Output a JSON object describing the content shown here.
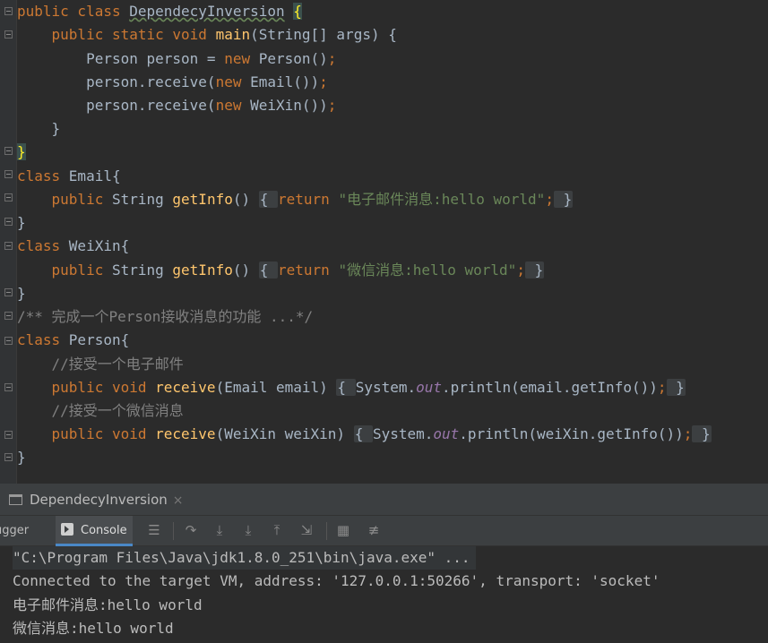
{
  "editor": {
    "lines": [
      [
        {
          "t": "public class ",
          "c": "kw"
        },
        {
          "t": "DependecyInversion",
          "c": "ul"
        },
        {
          "t": " "
        },
        {
          "t": "{",
          "c": "brhl"
        }
      ],
      [
        {
          "t": "    public static void ",
          "c": "kw"
        },
        {
          "t": "main",
          "c": "fn"
        },
        {
          "t": "(String[] args) {"
        }
      ],
      [
        {
          "t": "        Person person = "
        },
        {
          "t": "new ",
          "c": "kw"
        },
        {
          "t": "Person()"
        },
        {
          "t": ";",
          "c": "kw"
        }
      ],
      [
        {
          "t": "        person.receive("
        },
        {
          "t": "new ",
          "c": "kw"
        },
        {
          "t": "Email())"
        },
        {
          "t": ";",
          "c": "kw"
        }
      ],
      [
        {
          "t": "        person.receive("
        },
        {
          "t": "new ",
          "c": "kw"
        },
        {
          "t": "WeiXin())"
        },
        {
          "t": ";",
          "c": "kw"
        }
      ],
      [
        {
          "t": "    }"
        }
      ],
      [
        {
          "t": "}",
          "c": "brhl"
        }
      ],
      [
        {
          "t": "class ",
          "c": "kw"
        },
        {
          "t": "Email{"
        }
      ],
      [
        {
          "t": "    public ",
          "c": "kw"
        },
        {
          "t": "String "
        },
        {
          "t": "getInfo",
          "c": "fn"
        },
        {
          "t": "() "
        },
        {
          "t": "{ ",
          "c": "fb"
        },
        {
          "t": "return ",
          "c": "kw"
        },
        {
          "t": "\"电子邮件消息:hello world\"",
          "c": "str"
        },
        {
          "t": ";",
          "c": "kw"
        },
        {
          "t": " }",
          "c": "fb"
        }
      ],
      [
        {
          "t": "}"
        }
      ],
      [
        {
          "t": "class ",
          "c": "kw"
        },
        {
          "t": "WeiXin{"
        }
      ],
      [
        {
          "t": "    public ",
          "c": "kw"
        },
        {
          "t": "String "
        },
        {
          "t": "getInfo",
          "c": "fn"
        },
        {
          "t": "() "
        },
        {
          "t": "{ ",
          "c": "fb"
        },
        {
          "t": "return ",
          "c": "kw"
        },
        {
          "t": "\"微信消息:hello world\"",
          "c": "str"
        },
        {
          "t": ";",
          "c": "kw"
        },
        {
          "t": " }",
          "c": "fb"
        }
      ],
      [
        {
          "t": "}"
        }
      ],
      [
        {
          "t": "/** 完成一个Person接收消息的功能 ...*/",
          "c": "cm"
        }
      ],
      [
        {
          "t": "class ",
          "c": "kw"
        },
        {
          "t": "Person{"
        }
      ],
      [
        {
          "t": "    //接受一个电子邮件",
          "c": "cm"
        }
      ],
      [
        {
          "t": "    public void ",
          "c": "kw"
        },
        {
          "t": "receive",
          "c": "fn"
        },
        {
          "t": "(Email email) "
        },
        {
          "t": "{ ",
          "c": "fb"
        },
        {
          "t": "System."
        },
        {
          "t": "out",
          "c": "st"
        },
        {
          "t": ".println(email.getInfo())"
        },
        {
          "t": ";",
          "c": "kw"
        },
        {
          "t": " }",
          "c": "fb"
        }
      ],
      [
        {
          "t": "    //接受一个微信消息",
          "c": "cm"
        }
      ],
      [
        {
          "t": "    public void ",
          "c": "kw"
        },
        {
          "t": "receive",
          "c": "fn"
        },
        {
          "t": "(WeiXin weiXin) "
        },
        {
          "t": "{ ",
          "c": "fb"
        },
        {
          "t": "System."
        },
        {
          "t": "out",
          "c": "st"
        },
        {
          "t": ".println(weiXin.getInfo())"
        },
        {
          "t": ";",
          "c": "kw"
        },
        {
          "t": " }",
          "c": "fb"
        }
      ],
      [
        {
          "t": "}"
        }
      ]
    ]
  },
  "run_panel": {
    "tab_label": "DependecyInversion",
    "close_glyph": "×",
    "debugger_label": "ugger",
    "console_label": "Console",
    "toolbar_icons": [
      "menu-icon",
      "step-over-icon",
      "step-into-icon",
      "force-step-into-icon",
      "step-out-icon",
      "run-to-cursor-icon",
      "evaluate-icon",
      "trace-icon"
    ]
  },
  "console": {
    "lines": [
      "\"C:\\Program Files\\Java\\jdk1.8.0_251\\bin\\java.exe\" ...",
      "Connected to the target VM, address: '127.0.0.1:50266', transport: 'socket'",
      "电子邮件消息:hello world",
      "微信消息:hello world"
    ]
  },
  "colors": {
    "editor_bg": "#2b2b2b",
    "keyword": "#cc7832",
    "method": "#ffc66d",
    "string": "#6a8759",
    "comment": "#808080",
    "static_field": "#9876aa"
  }
}
